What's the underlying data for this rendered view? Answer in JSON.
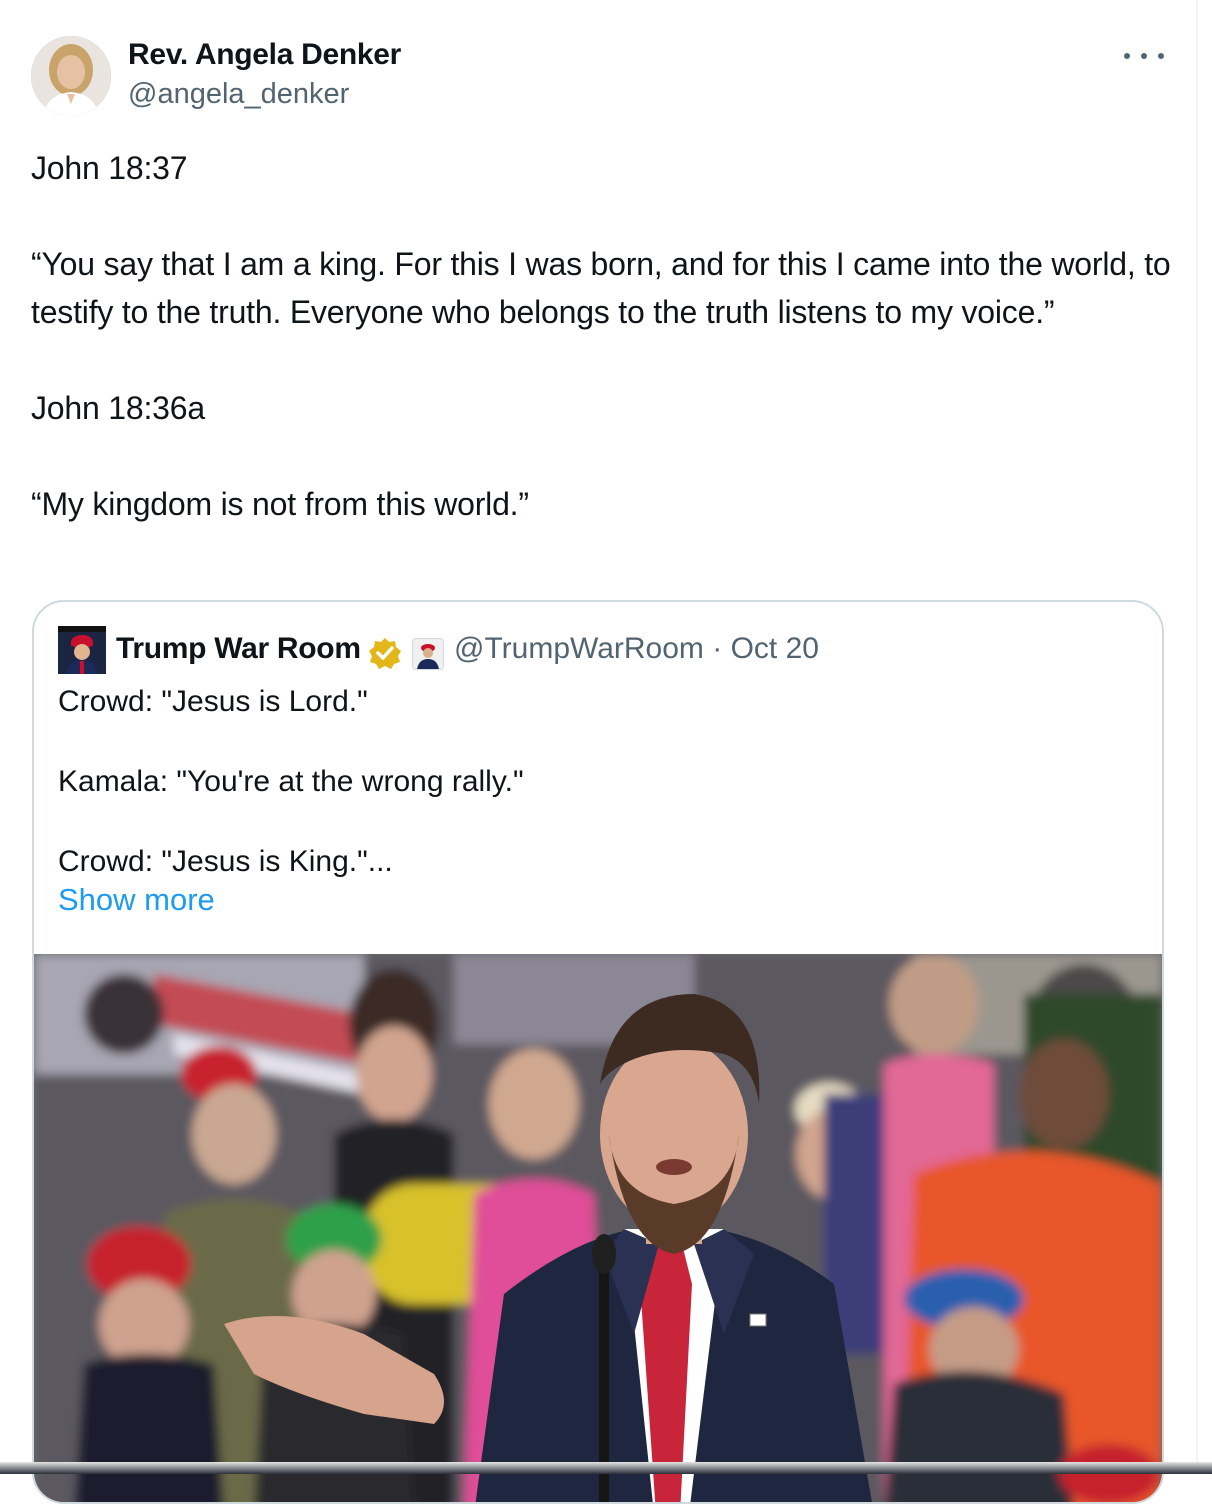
{
  "tweet": {
    "author": {
      "display_name": "Rev. Angela Denker",
      "handle": "@angela_denker"
    },
    "more_icon": "more-horizontal-icon",
    "text": "John 18:37\n\n“You say that I am a king. For this I was born, and for this I came into the world, to testify to the truth. Everyone who belongs to the truth listens to my voice.”\n\nJohn 18:36a\n\n“My kingdom is not from this world.”"
  },
  "quoted_tweet": {
    "display_name": "Trump War Room",
    "verified_icon": "verified-gold-badge-icon",
    "affiliation_icon": "affiliate-badge-icon",
    "handle_date": "@TrumpWarRoom · Oct 20",
    "text": "Crowd: \"Jesus is Lord.\"\n\nKamala: \"You're at the wrong rally.\"\n\nCrowd: \"Jesus is King.\"...",
    "show_more_label": "Show more",
    "media": "rally-video-thumbnail"
  },
  "colors": {
    "text": "#0f1419",
    "secondary": "#536471",
    "link": "#1d9bf0",
    "border": "#cfd9de",
    "verified": "#e2b719"
  }
}
